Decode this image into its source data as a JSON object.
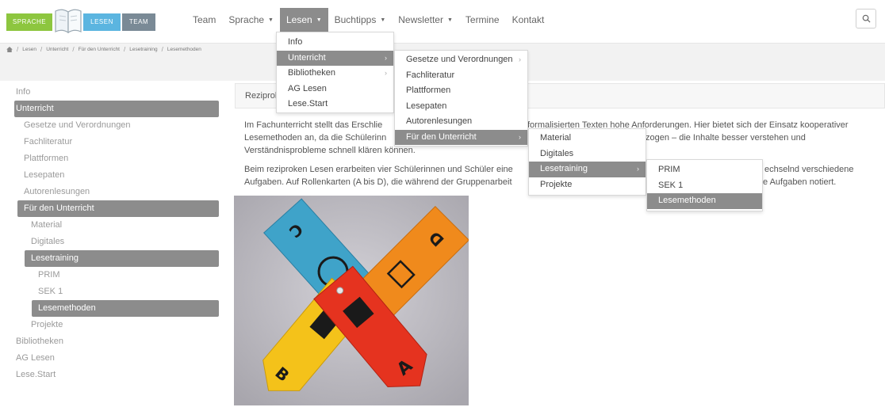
{
  "logo": {
    "part1": "SPRACHE",
    "part2": "LESEN",
    "part3": "TEAM"
  },
  "nav": [
    {
      "label": "Team",
      "has_caret": false
    },
    {
      "label": "Sprache",
      "has_caret": true
    },
    {
      "label": "Lesen",
      "has_caret": true,
      "active": true
    },
    {
      "label": "Buchtipps",
      "has_caret": true
    },
    {
      "label": "Newsletter",
      "has_caret": true
    },
    {
      "label": "Termine",
      "has_caret": false
    },
    {
      "label": "Kontakt",
      "has_caret": false
    }
  ],
  "search_icon": "search-icon",
  "breadcrumb": [
    "Lesen",
    "Unterricht",
    "Für den Unterricht",
    "Lesetraining",
    "Lesemethoden"
  ],
  "sidebar": [
    {
      "label": "Info",
      "level": 0
    },
    {
      "label": "Unterricht",
      "level": 0,
      "active": true
    },
    {
      "label": "Gesetze und Verordnungen",
      "level": 1
    },
    {
      "label": "Fachliteratur",
      "level": 1
    },
    {
      "label": "Plattformen",
      "level": 1
    },
    {
      "label": "Lesepaten",
      "level": 1
    },
    {
      "label": "Autorenlesungen",
      "level": 1
    },
    {
      "label": "Für den Unterricht",
      "level": 1,
      "active": true
    },
    {
      "label": "Material",
      "level": 2
    },
    {
      "label": "Digitales",
      "level": 2
    },
    {
      "label": "Lesetraining",
      "level": 2,
      "active": true
    },
    {
      "label": "PRIM",
      "level": 3
    },
    {
      "label": "SEK 1",
      "level": 3
    },
    {
      "label": "Lesemethoden",
      "level": 3,
      "active": true
    },
    {
      "label": "Projekte",
      "level": 2
    },
    {
      "label": "Bibliotheken",
      "level": 0
    },
    {
      "label": "AG Lesen",
      "level": 0
    },
    {
      "label": "Lese.Start",
      "level": 0
    }
  ],
  "main": {
    "heading": "Reziprok",
    "paragraphs": [
      "Im Fachunterricht stellt das Erschlie",
      "formalisierten Texten hohe Anforderungen. Hier bietet sich der Einsatz kooperativer",
      "Lesemethoden an, da die Schülerinn",
      "zogen – die Inhalte besser verstehen und",
      "Verständnisprobleme schnell klären können.",
      "Beim reziproken Lesen erarbeiten vier Schülerinnen und Schüler eine",
      "echselnd verschiedene",
      "Aufgaben. Auf Rollenkarten (A bis D), die während der Gruppenarbeit",
      "e Aufgaben notiert."
    ]
  },
  "photo": {
    "card_letters": [
      "C",
      "D",
      "B",
      "A"
    ],
    "colors": {
      "blue": "#3fa3c9",
      "orange": "#f08a1c",
      "yellow": "#f4c21a",
      "red": "#e5331f"
    }
  },
  "menu_lesen": [
    {
      "label": "Info",
      "has_sub": false
    },
    {
      "label": "Unterricht",
      "has_sub": true,
      "active": true
    },
    {
      "label": "Bibliotheken",
      "has_sub": true
    },
    {
      "label": "AG Lesen",
      "has_sub": false
    },
    {
      "label": "Lese.Start",
      "has_sub": false
    }
  ],
  "menu_unterricht": [
    {
      "label": "Gesetze und Verordnungen",
      "has_sub": true
    },
    {
      "label": "Fachliteratur",
      "has_sub": false
    },
    {
      "label": "Plattformen",
      "has_sub": false
    },
    {
      "label": "Lesepaten",
      "has_sub": false
    },
    {
      "label": "Autorenlesungen",
      "has_sub": false
    },
    {
      "label": "Für den Unterricht",
      "has_sub": true,
      "active": true
    }
  ],
  "menu_fdu": [
    {
      "label": "Material",
      "has_sub": false
    },
    {
      "label": "Digitales",
      "has_sub": false
    },
    {
      "label": "Lesetraining",
      "has_sub": true,
      "active": true
    },
    {
      "label": "Projekte",
      "has_sub": false
    }
  ],
  "menu_lesetraining": [
    {
      "label": "PRIM",
      "has_sub": false
    },
    {
      "label": "SEK 1",
      "has_sub": false
    },
    {
      "label": "Lesemethoden",
      "has_sub": false,
      "active": true
    }
  ]
}
